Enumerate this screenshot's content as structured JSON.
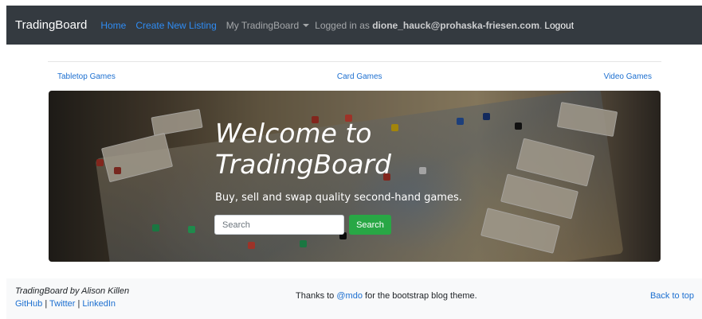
{
  "navbar": {
    "brand": "TradingBoard",
    "home": "Home",
    "create_listing": "Create New Listing",
    "my_board": "My TradingBoard",
    "logged_prefix": "Logged in as",
    "user_email": "dione_hauck@prohaska-friesen.com",
    "logged_suffix": ".",
    "logout": "Logout"
  },
  "categories": {
    "tabletop": "Tabletop Games",
    "card": "Card Games",
    "video": "Video Games"
  },
  "hero": {
    "title": "Welcome to\nTradingBoard",
    "lead": "Buy, sell and swap quality second-hand games.",
    "search_placeholder": "Search",
    "search_button": "Search"
  },
  "footer": {
    "credit": "TradingBoard by Alison Killen",
    "github": "GitHub",
    "twitter": "Twitter",
    "linkedin": "LinkedIn",
    "separator": "|",
    "thanks_prefix": "Thanks to",
    "thanks_handle": "@mdo",
    "thanks_suffix": "for the bootstrap blog theme.",
    "back_to_top": "Back to top"
  },
  "colors": {
    "navbar_bg": "#343a40",
    "link": "#1c6fd0",
    "search_button": "#28a745",
    "footer_bg": "#f8f9fa"
  }
}
